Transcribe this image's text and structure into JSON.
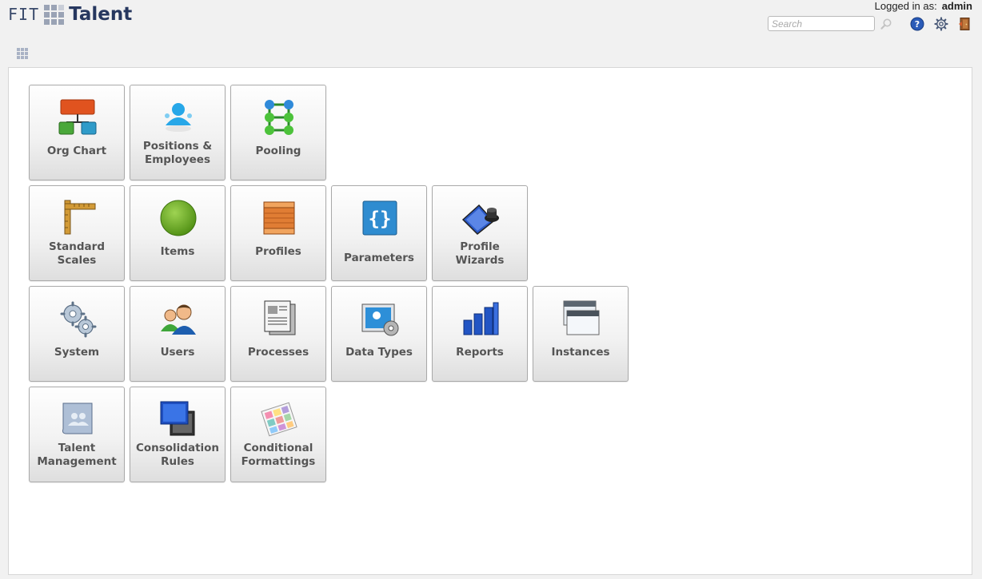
{
  "header": {
    "logo_left": "FIT",
    "logo_right": "Talent",
    "login_prefix": "Logged in as:",
    "login_user": "admin",
    "search_placeholder": "Search"
  },
  "tiles": [
    {
      "label": "Org Chart",
      "icon": "org-chart-icon"
    },
    {
      "label": "Positions & Employees",
      "icon": "positions-icon"
    },
    {
      "label": "Pooling",
      "icon": "pooling-icon"
    },
    {
      "label": "Standard Scales",
      "icon": "scales-icon"
    },
    {
      "label": "Items",
      "icon": "items-icon"
    },
    {
      "label": "Profiles",
      "icon": "profiles-icon"
    },
    {
      "label": "Parameters",
      "icon": "parameters-icon"
    },
    {
      "label": "Profile Wizards",
      "icon": "profile-wizards-icon"
    },
    {
      "label": "System",
      "icon": "system-icon"
    },
    {
      "label": "Users",
      "icon": "users-icon"
    },
    {
      "label": "Processes",
      "icon": "processes-icon"
    },
    {
      "label": "Data Types",
      "icon": "data-types-icon"
    },
    {
      "label": "Reports",
      "icon": "reports-icon"
    },
    {
      "label": "Instances",
      "icon": "instances-icon"
    },
    {
      "label": "Talent Management",
      "icon": "talent-management-icon"
    },
    {
      "label": "Consolidation Rules",
      "icon": "consolidation-rules-icon"
    },
    {
      "label": "Conditional Formattings",
      "icon": "conditional-formattings-icon"
    }
  ]
}
